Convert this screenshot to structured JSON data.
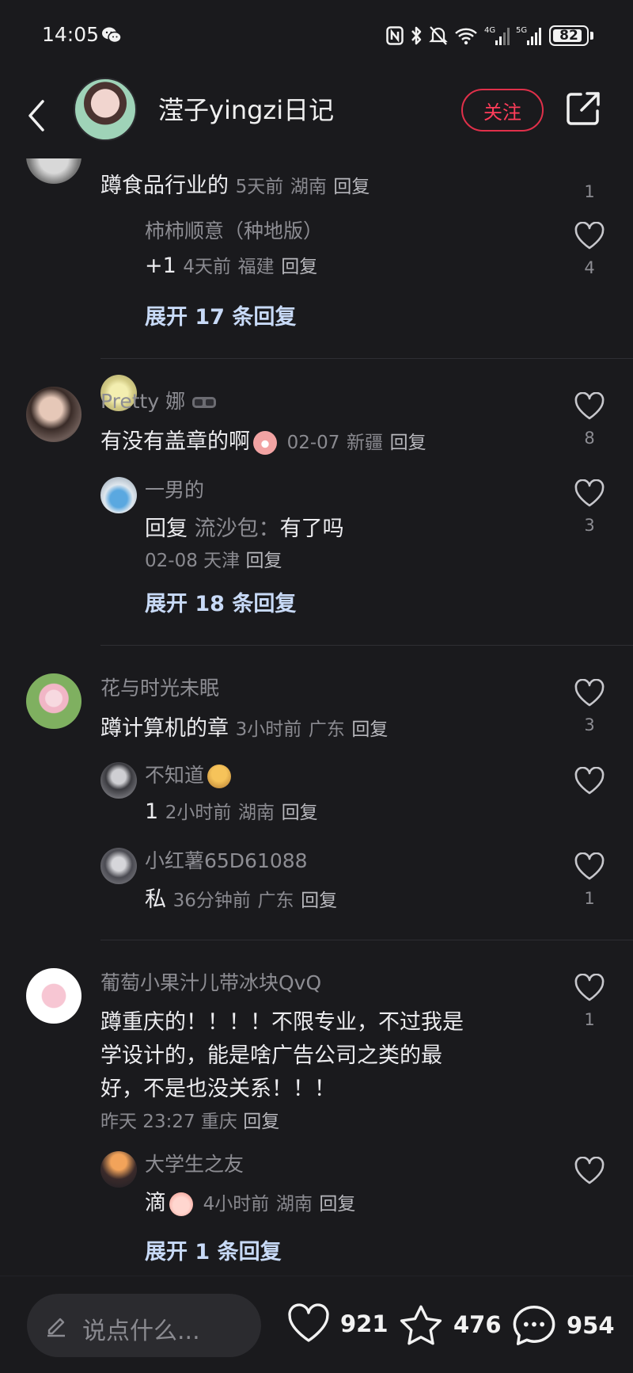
{
  "status_bar": {
    "time": "14:05",
    "battery": "82",
    "icons": [
      "wechat-icon",
      "nfc-icon",
      "bluetooth-icon",
      "mute-icon",
      "wifi-icon",
      "signal-4g-icon",
      "signal-5g-icon"
    ]
  },
  "header": {
    "title": "滢子yingzi日记",
    "follow_label": "关注"
  },
  "comments": {
    "c0": {
      "text": "蹲食品行业的",
      "time": "5天前",
      "location": "湖南",
      "reply": "回复",
      "likes": "1",
      "replies": {
        "r0": {
          "name": "柿柿顺意（种地版）",
          "text": "+1",
          "time": "4天前",
          "location": "福建",
          "reply": "回复",
          "likes": "4"
        }
      },
      "expand": "展开 17 条回复"
    },
    "c1": {
      "name": "Pretty 娜",
      "text": "有没有盖章的啊",
      "time": "02-07",
      "location": "新疆",
      "reply": "回复",
      "likes": "8",
      "replies": {
        "r0": {
          "name": "一男的",
          "text_prefix": "回复",
          "reply_to": "流沙包：",
          "text": "有了吗",
          "time": "02-08",
          "location": "天津",
          "reply": "回复",
          "likes": "3"
        }
      },
      "expand": "展开 18 条回复"
    },
    "c2": {
      "name": "花与时光未眠",
      "text": "蹲计算机的章",
      "time": "3小时前",
      "location": "广东",
      "reply": "回复",
      "likes": "3",
      "replies": {
        "r0": {
          "name": "不知道",
          "text": "1",
          "time": "2小时前",
          "location": "湖南",
          "reply": "回复",
          "likes": ""
        },
        "r1": {
          "name": "小红薯65D61088",
          "text": "私",
          "time": "36分钟前",
          "location": "广东",
          "reply": "回复",
          "likes": "1"
        }
      }
    },
    "c3": {
      "name": "葡萄小果汁儿带冰块QvQ",
      "text_line1": "蹲重庆的！！！！不限专业，不过我是",
      "text_line2": "学设计的，能是啥广告公司之类的最",
      "text_line3": "好，不是也没关系！！！",
      "time": "昨天 23:27",
      "location": "重庆",
      "reply": "回复",
      "likes": "1",
      "replies": {
        "r0": {
          "name": "大学生之友",
          "text": "滴",
          "time": "4小时前",
          "location": "湖南",
          "reply": "回复",
          "likes": ""
        }
      },
      "expand": "展开 1 条回复"
    }
  },
  "bottom_bar": {
    "placeholder": "说点什么...",
    "likes": "921",
    "favorites": "476",
    "comments": "954"
  },
  "colors": {
    "background": "#1a1a1d",
    "accent_red": "#ff3d5a",
    "expand_blue": "#c8daf7"
  }
}
